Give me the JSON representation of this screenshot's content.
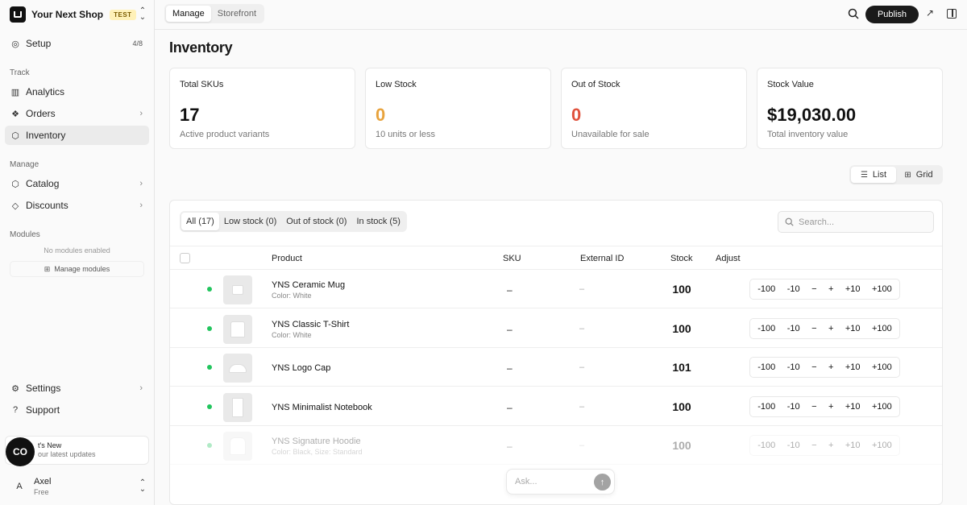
{
  "shop": {
    "name": "Your Next Shop",
    "env_badge": "TEST"
  },
  "sidebar": {
    "setup": {
      "label": "Setup",
      "count": "4/8"
    },
    "track_label": "Track",
    "track_items": [
      {
        "label": "Analytics",
        "icon": "bar-chart-icon"
      },
      {
        "label": "Orders",
        "icon": "boxes-icon"
      },
      {
        "label": "Inventory",
        "icon": "package-icon"
      }
    ],
    "manage_label": "Manage",
    "manage_items": [
      {
        "label": "Catalog",
        "icon": "box-icon"
      },
      {
        "label": "Discounts",
        "icon": "tag-icon"
      }
    ],
    "modules_label": "Modules",
    "no_modules": "No modules enabled",
    "manage_modules": "Manage modules",
    "settings": "Settings",
    "support": "Support",
    "whats_new_title": "t's New",
    "whats_new_sub": "our latest updates",
    "user": {
      "initial": "A",
      "name": "Axel",
      "plan": "Free"
    }
  },
  "topbar": {
    "tabs": [
      "Manage",
      "Storefront"
    ],
    "publish": "Publish"
  },
  "page": {
    "title": "Inventory"
  },
  "stats": [
    {
      "label": "Total SKUs",
      "value": "17",
      "sub": "Active product variants",
      "color": "#111111"
    },
    {
      "label": "Low Stock",
      "value": "0",
      "sub": "10 units or less",
      "color": "#e8a33d"
    },
    {
      "label": "Out of Stock",
      "value": "0",
      "sub": "Unavailable for sale",
      "color": "#e0523d"
    },
    {
      "label": "Stock Value",
      "value": "$19,030.00",
      "sub": "Total inventory value",
      "color": "#111111"
    }
  ],
  "view_toggle": {
    "list": "List",
    "grid": "Grid"
  },
  "filters": [
    "All (17)",
    "Low stock (0)",
    "Out of stock (0)",
    "In stock (5)"
  ],
  "search": {
    "placeholder": "Search..."
  },
  "columns": {
    "product": "Product",
    "sku": "SKU",
    "external_id": "External ID",
    "stock": "Stock",
    "adjust": "Adjust"
  },
  "adjust_buttons": [
    "-100",
    "-10",
    "−",
    "+",
    "+10",
    "+100"
  ],
  "rows": [
    {
      "name": "YNS Ceramic Mug",
      "variant": "Color: White",
      "sku": "–",
      "external_id": "–",
      "stock": "100",
      "thumb": "mug-image"
    },
    {
      "name": "YNS Classic T-Shirt",
      "variant": "Color: White",
      "sku": "–",
      "external_id": "–",
      "stock": "100",
      "thumb": "tshirt-image"
    },
    {
      "name": "YNS Logo Cap",
      "variant": "",
      "sku": "–",
      "external_id": "–",
      "stock": "101",
      "thumb": "cap-image"
    },
    {
      "name": "YNS Minimalist Notebook",
      "variant": "",
      "sku": "–",
      "external_id": "–",
      "stock": "100",
      "thumb": "notebook-image"
    },
    {
      "name": "YNS Signature Hoodie",
      "variant": "Color: Black, Size: Standard",
      "sku": "–",
      "external_id": "–",
      "stock": "100",
      "thumb": "hoodie-image"
    }
  ],
  "ask": {
    "placeholder": "Ask..."
  }
}
